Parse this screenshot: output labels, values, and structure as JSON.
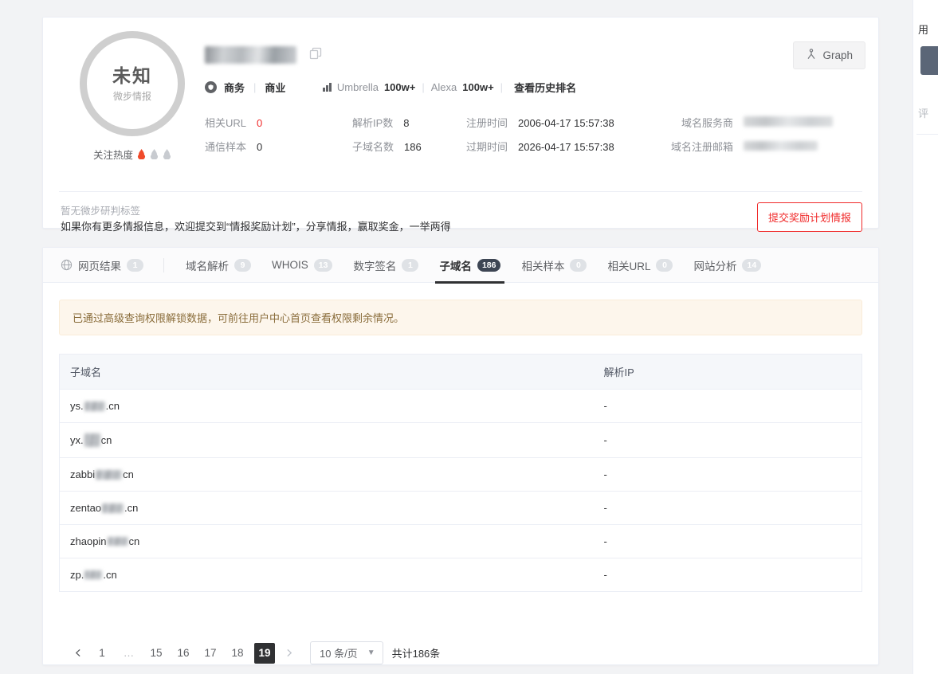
{
  "profile": {
    "score_label": "未知",
    "score_source": "微步情报",
    "heat_label": "关注热度",
    "heat_level": 1,
    "heat_total": 3,
    "domain_redacted": true,
    "copy_icon": "copy-icon",
    "category_icon": "shield-icon",
    "category_primary": "商务",
    "category_secondary": "商业",
    "rank": [
      {
        "name": "Umbrella",
        "value": "100w+"
      },
      {
        "name": "Alexa",
        "value": "100w+"
      }
    ],
    "history_rank_link": "查看历史排名",
    "graph_button": "Graph",
    "graph_icon": "graph-node-icon",
    "stats": [
      {
        "label": "相关URL",
        "value": "0",
        "accent": "#f02a2a"
      },
      {
        "label": "通信样本",
        "value": "0",
        "accent": ""
      },
      {
        "label": "解析IP数",
        "value": "8",
        "accent": ""
      },
      {
        "label": "子域名数",
        "value": "186",
        "accent": ""
      },
      {
        "label": "注册时间",
        "value": "2006-04-17 15:57:38",
        "accent": ""
      },
      {
        "label": "过期时间",
        "value": "2026-04-17 15:57:38",
        "accent": ""
      },
      {
        "label": "域名服务商",
        "value": "",
        "redacted": true
      },
      {
        "label": "域名注册邮箱",
        "value": "",
        "redacted": true
      }
    ],
    "tag_note": "暂无微步研判标签",
    "promo_note": "如果你有更多情报信息，欢迎提交到“情报奖励计划”，分享情报，赢取奖金，一举两得",
    "submit_button": "提交奖励计划情报"
  },
  "tabs": [
    {
      "label": "网页结果",
      "badge": "1",
      "icon": "globe-icon",
      "active": false
    },
    {
      "label": "域名解析",
      "badge": "9",
      "icon": "",
      "active": false
    },
    {
      "label": "WHOIS",
      "badge": "13",
      "icon": "",
      "active": false
    },
    {
      "label": "数字签名",
      "badge": "1",
      "icon": "",
      "active": false
    },
    {
      "label": "子域名",
      "badge": "186",
      "icon": "",
      "active": true
    },
    {
      "label": "相关样本",
      "badge": "0",
      "icon": "",
      "active": false
    },
    {
      "label": "相关URL",
      "badge": "0",
      "icon": "",
      "active": false
    },
    {
      "label": "网站分析",
      "badge": "14",
      "icon": "",
      "active": false
    }
  ],
  "panel": {
    "notice": "已通过高级查询权限解锁数据，可前往用户中心首页查看权限剩余情况。",
    "table": {
      "columns": [
        "子域名",
        "解析IP"
      ],
      "rows": [
        {
          "prefix": "ys.",
          "redact_w": 26,
          "suffix": ".cn",
          "ip": "-"
        },
        {
          "prefix": "yx.",
          "redact_w": 20,
          "suffix": " cn",
          "ip": "-"
        },
        {
          "prefix": "zabbi",
          "redact_w": 33,
          "suffix": "cn",
          "ip": "-"
        },
        {
          "prefix": "zentao",
          "redact_w": 27,
          "suffix": ".cn",
          "ip": "-"
        },
        {
          "prefix": "zhaopin",
          "redact_w": 26,
          "suffix": "cn",
          "ip": "-"
        },
        {
          "prefix": "zp.",
          "redact_w": 22,
          "suffix": ".cn",
          "ip": "-"
        }
      ]
    },
    "pagination": {
      "prev_icon": "chevron-left-icon",
      "next_icon": "chevron-right-icon",
      "pages": [
        "1",
        "…",
        "15",
        "16",
        "17",
        "18",
        "19"
      ],
      "current": "19",
      "page_size": "10 条/页",
      "caret_icon": "chevron-down-icon",
      "total": "共计186条"
    }
  },
  "right_rail": {
    "title": "用",
    "label": "评"
  }
}
